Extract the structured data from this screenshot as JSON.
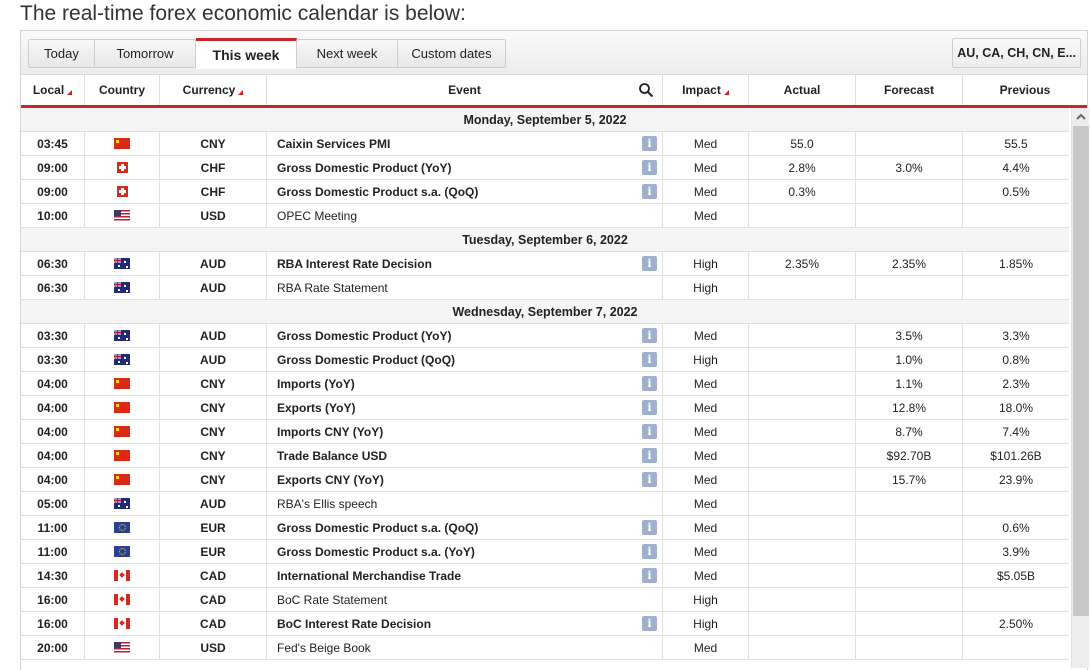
{
  "intro_text": "The real-time forex economic calendar is below:",
  "tabs": [
    {
      "label": "Today",
      "active": false
    },
    {
      "label": "Tomorrow",
      "active": false
    },
    {
      "label": "This week",
      "active": true
    },
    {
      "label": "Next week",
      "active": false
    },
    {
      "label": "Custom dates",
      "active": false
    }
  ],
  "country_filter": "AU, CA, CH, CN, E...",
  "columns": {
    "local": "Local",
    "country": "Country",
    "currency": "Currency",
    "event": "Event",
    "impact": "Impact",
    "actual": "Actual",
    "forecast": "Forecast",
    "previous": "Previous"
  },
  "accent_color": "#c9262c",
  "days": [
    {
      "label": "Monday, September 5, 2022",
      "events": [
        {
          "time": "03:45",
          "flag": "cn",
          "currency": "CNY",
          "event": "Caixin Services PMI",
          "bold": true,
          "info": true,
          "impact": "Med",
          "actual": "55.0",
          "forecast": "",
          "previous": "55.5"
        },
        {
          "time": "09:00",
          "flag": "ch",
          "currency": "CHF",
          "event": "Gross Domestic Product (YoY)",
          "bold": true,
          "info": true,
          "impact": "Med",
          "actual": "2.8%",
          "forecast": "3.0%",
          "previous": "4.4%"
        },
        {
          "time": "09:00",
          "flag": "ch",
          "currency": "CHF",
          "event": "Gross Domestic Product s.a. (QoQ)",
          "bold": true,
          "info": true,
          "impact": "Med",
          "actual": "0.3%",
          "forecast": "",
          "previous": "0.5%"
        },
        {
          "time": "10:00",
          "flag": "us",
          "currency": "USD",
          "event": "OPEC Meeting",
          "bold": false,
          "info": false,
          "impact": "Med",
          "actual": "",
          "forecast": "",
          "previous": ""
        }
      ]
    },
    {
      "label": "Tuesday, September 6, 2022",
      "events": [
        {
          "time": "06:30",
          "flag": "au",
          "currency": "AUD",
          "event": "RBA Interest Rate Decision",
          "bold": true,
          "info": true,
          "impact": "High",
          "actual": "2.35%",
          "forecast": "2.35%",
          "previous": "1.85%"
        },
        {
          "time": "06:30",
          "flag": "au",
          "currency": "AUD",
          "event": "RBA Rate Statement",
          "bold": false,
          "info": false,
          "impact": "High",
          "actual": "",
          "forecast": "",
          "previous": ""
        }
      ]
    },
    {
      "label": "Wednesday, September 7, 2022",
      "events": [
        {
          "time": "03:30",
          "flag": "au",
          "currency": "AUD",
          "event": "Gross Domestic Product (YoY)",
          "bold": true,
          "info": true,
          "impact": "Med",
          "actual": "",
          "forecast": "3.5%",
          "previous": "3.3%"
        },
        {
          "time": "03:30",
          "flag": "au",
          "currency": "AUD",
          "event": "Gross Domestic Product (QoQ)",
          "bold": true,
          "info": true,
          "impact": "High",
          "actual": "",
          "forecast": "1.0%",
          "previous": "0.8%"
        },
        {
          "time": "04:00",
          "flag": "cn",
          "currency": "CNY",
          "event": "Imports (YoY)",
          "bold": true,
          "info": true,
          "impact": "Med",
          "actual": "",
          "forecast": "1.1%",
          "previous": "2.3%"
        },
        {
          "time": "04:00",
          "flag": "cn",
          "currency": "CNY",
          "event": "Exports (YoY)",
          "bold": true,
          "info": true,
          "impact": "Med",
          "actual": "",
          "forecast": "12.8%",
          "previous": "18.0%"
        },
        {
          "time": "04:00",
          "flag": "cn",
          "currency": "CNY",
          "event": "Imports CNY (YoY)",
          "bold": true,
          "info": true,
          "impact": "Med",
          "actual": "",
          "forecast": "8.7%",
          "previous": "7.4%"
        },
        {
          "time": "04:00",
          "flag": "cn",
          "currency": "CNY",
          "event": "Trade Balance USD",
          "bold": true,
          "info": true,
          "impact": "Med",
          "actual": "",
          "forecast": "$92.70B",
          "previous": "$101.26B"
        },
        {
          "time": "04:00",
          "flag": "cn",
          "currency": "CNY",
          "event": "Exports CNY (YoY)",
          "bold": true,
          "info": true,
          "impact": "Med",
          "actual": "",
          "forecast": "15.7%",
          "previous": "23.9%"
        },
        {
          "time": "05:00",
          "flag": "au",
          "currency": "AUD",
          "event": "RBA's Ellis speech",
          "bold": false,
          "info": false,
          "impact": "Med",
          "actual": "",
          "forecast": "",
          "previous": ""
        },
        {
          "time": "11:00",
          "flag": "eu",
          "currency": "EUR",
          "event": "Gross Domestic Product s.a. (QoQ)",
          "bold": true,
          "info": true,
          "impact": "Med",
          "actual": "",
          "forecast": "",
          "previous": "0.6%"
        },
        {
          "time": "11:00",
          "flag": "eu",
          "currency": "EUR",
          "event": "Gross Domestic Product s.a. (YoY)",
          "bold": true,
          "info": true,
          "impact": "Med",
          "actual": "",
          "forecast": "",
          "previous": "3.9%"
        },
        {
          "time": "14:30",
          "flag": "ca",
          "currency": "CAD",
          "event": "International Merchandise Trade",
          "bold": true,
          "info": true,
          "impact": "Med",
          "actual": "",
          "forecast": "",
          "previous": "$5.05B"
        },
        {
          "time": "16:00",
          "flag": "ca",
          "currency": "CAD",
          "event": "BoC Rate Statement",
          "bold": false,
          "info": false,
          "impact": "High",
          "actual": "",
          "forecast": "",
          "previous": ""
        },
        {
          "time": "16:00",
          "flag": "ca",
          "currency": "CAD",
          "event": "BoC Interest Rate Decision",
          "bold": true,
          "info": true,
          "impact": "High",
          "actual": "",
          "forecast": "",
          "previous": "2.50%"
        },
        {
          "time": "20:00",
          "flag": "us",
          "currency": "USD",
          "event": "Fed's Beige Book",
          "bold": false,
          "info": false,
          "impact": "Med",
          "actual": "",
          "forecast": "",
          "previous": ""
        }
      ]
    }
  ]
}
